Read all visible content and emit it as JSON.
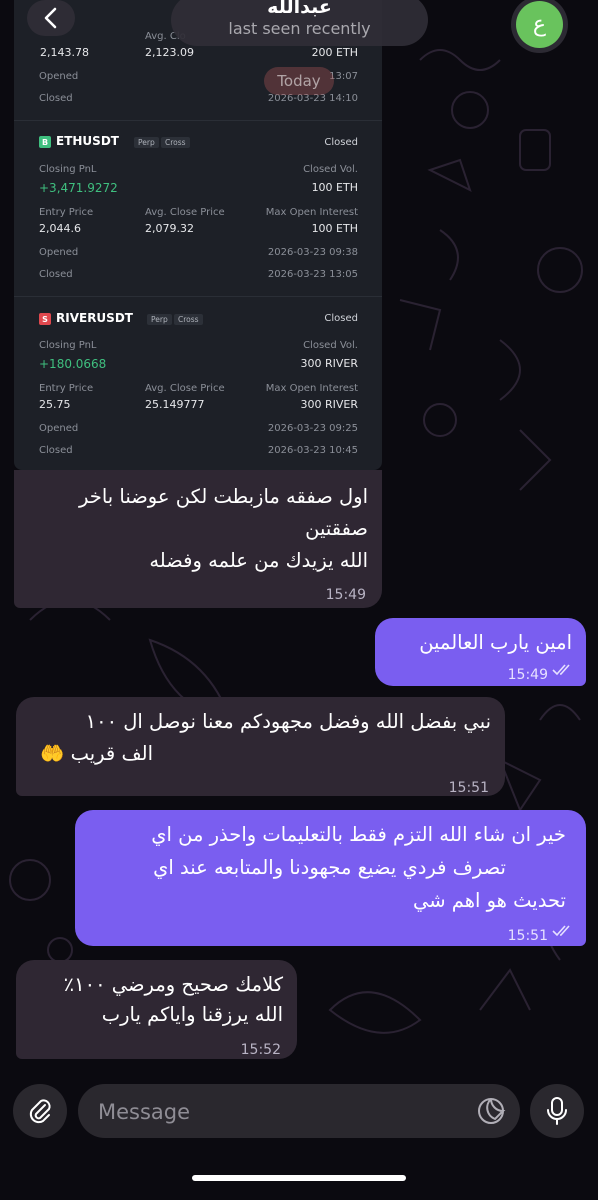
{
  "header": {
    "contact_name": "عبدالله",
    "status": "last seen recently",
    "avatar_letter": "ع",
    "avatar_color": "#69c35d"
  },
  "date_badge": "Today",
  "trade_card": {
    "top_partial": {
      "entry_price": "2,143.78",
      "avg_close_price": "2,123.09",
      "max_open_interest": "200 ETH",
      "opened_label": "Opened",
      "opened_time": "13:07",
      "closed_label": "Closed",
      "closed_time": "2026-03-23 14:10",
      "avg_label": "Avg. Clo"
    },
    "trades": [
      {
        "symbol": "ETHUSDT",
        "coin_letter": "B",
        "coin_color": "#3fbf7f",
        "tag1": "Perp",
        "tag2": "Cross",
        "status": "Closed",
        "pnl_label": "Closing PnL",
        "pnl": "+3,471.9272",
        "vol_label": "Closed Vol.",
        "vol": "100 ETH",
        "entry_label": "Entry Price",
        "entry": "2,044.6",
        "avg_label": "Avg. Close Price",
        "avg": "2,079.32",
        "max_label": "Max Open Interest",
        "max": "100 ETH",
        "opened_label": "Opened",
        "opened": "2026-03-23 09:38",
        "closed_label": "Closed",
        "closed": "2026-03-23 13:05"
      },
      {
        "symbol": "RIVERUSDT",
        "coin_letter": "S",
        "coin_color": "#e0484e",
        "tag1": "Perp",
        "tag2": "Cross",
        "status": "Closed",
        "pnl_label": "Closing PnL",
        "pnl": "+180.0668",
        "vol_label": "Closed Vol.",
        "vol": "300 RIVER",
        "entry_label": "Entry Price",
        "entry": "25.75",
        "avg_label": "Avg. Close Price",
        "avg": "25.149777",
        "max_label": "Max Open Interest",
        "max": "300 RIVER",
        "opened_label": "Opened",
        "opened": "2026-03-23 09:25",
        "closed_label": "Closed",
        "closed": "2026-03-23 10:45"
      }
    ]
  },
  "messages": [
    {
      "direction": "in",
      "lines": [
        "اول صفقه مازبطت لكن عوضنا باخر",
        "صفقتين",
        "الله يزيدك من علمه وفضله"
      ],
      "time": "15:49"
    },
    {
      "direction": "out",
      "lines": [
        "امين يارب العالمين"
      ],
      "time": "15:49"
    },
    {
      "direction": "in",
      "lines": [
        "نبي بفضل الله وفضل مجهودكم معنا نوصل ال ١٠٠",
        "الف قريب 🤲"
      ],
      "time": "15:51"
    },
    {
      "direction": "out",
      "lines": [
        "خير ان شاء الله التزم فقط بالتعليمات واحذر من اي",
        "تصرف فردي يضيع مجهودنا والمتابعه عند اي",
        "تحديث هو اهم شي"
      ],
      "time": "15:51"
    },
    {
      "direction": "in",
      "lines": [
        "كلامك صحيح ومرضي ١٠٠٪",
        "الله يرزقنا واياكم يارب"
      ],
      "time": "15:52"
    }
  ],
  "composer": {
    "placeholder": "Message"
  },
  "colors": {
    "incoming_bubble": "#2f2733",
    "outgoing_bubble": "#7a5ef0",
    "background": "#0b0a10"
  }
}
